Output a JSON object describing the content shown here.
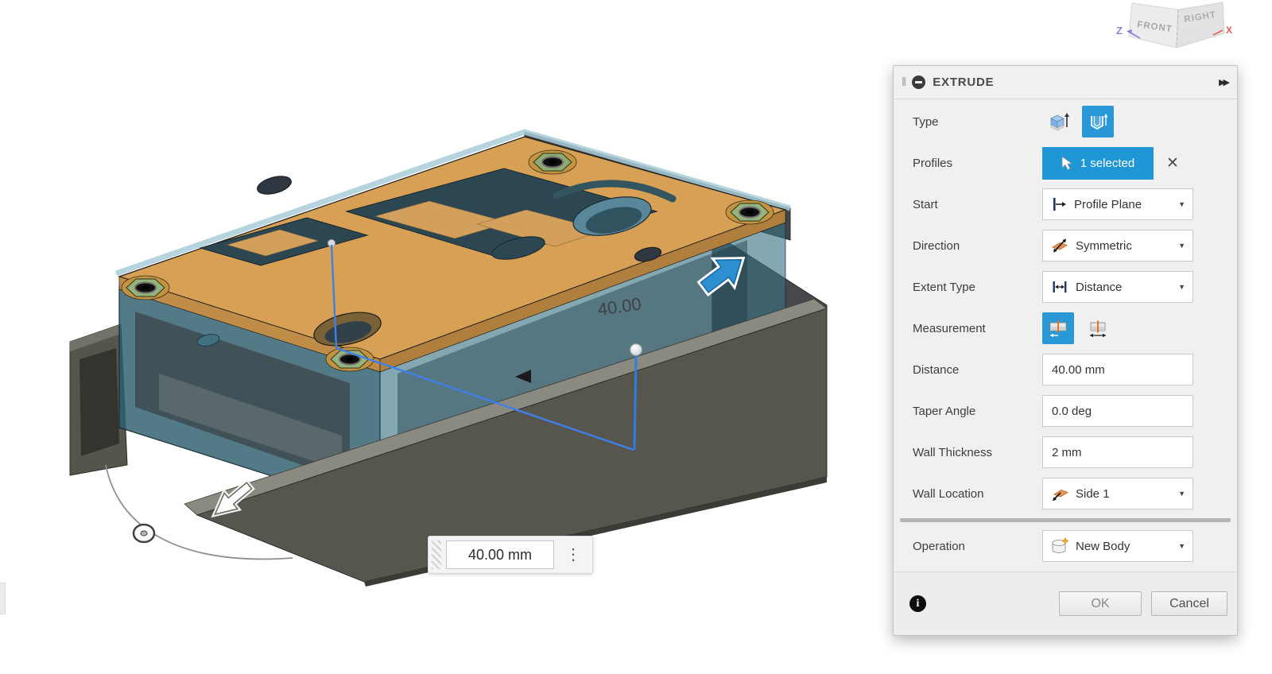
{
  "viewport": {
    "dimension_label": "40.00",
    "dimension_input_value": "40.00 mm",
    "view_cube": {
      "front": "FRONT",
      "right": "RIGHT",
      "z": "Z",
      "x": "X"
    }
  },
  "dialog": {
    "title": "EXTRUDE",
    "type": {
      "label": "Type",
      "options": [
        "solid-extrude",
        "thin-extrude"
      ],
      "selected_index": 1
    },
    "profiles": {
      "label": "Profiles",
      "value": "1 selected"
    },
    "start": {
      "label": "Start",
      "value": "Profile Plane"
    },
    "direction": {
      "label": "Direction",
      "value": "Symmetric"
    },
    "extent_type": {
      "label": "Extent Type",
      "value": "Distance"
    },
    "measurement": {
      "label": "Measurement",
      "selected_index": 0
    },
    "distance": {
      "label": "Distance",
      "value": "40.00 mm"
    },
    "taper_angle": {
      "label": "Taper Angle",
      "value": "0.0 deg"
    },
    "wall_thickness": {
      "label": "Wall Thickness",
      "value": "2 mm"
    },
    "wall_location": {
      "label": "Wall Location",
      "value": "Side 1"
    },
    "operation": {
      "label": "Operation",
      "value": "New Body"
    },
    "buttons": {
      "ok": "OK",
      "cancel": "Cancel"
    }
  },
  "icons": {
    "grip": "‖",
    "skip_forward": "▶▶",
    "close": "✕",
    "caret": "▼",
    "dots_menu": "⋮",
    "info": "i"
  },
  "colors": {
    "accent_blue": "#1f97d6",
    "selected_tile_blue": "#2a98d6",
    "plate_orange": "#d7a055",
    "thin_wall_teal": "#2c5e6c",
    "shell_gray": "#57564e",
    "manipulator_blue": "#2e8fd0"
  }
}
